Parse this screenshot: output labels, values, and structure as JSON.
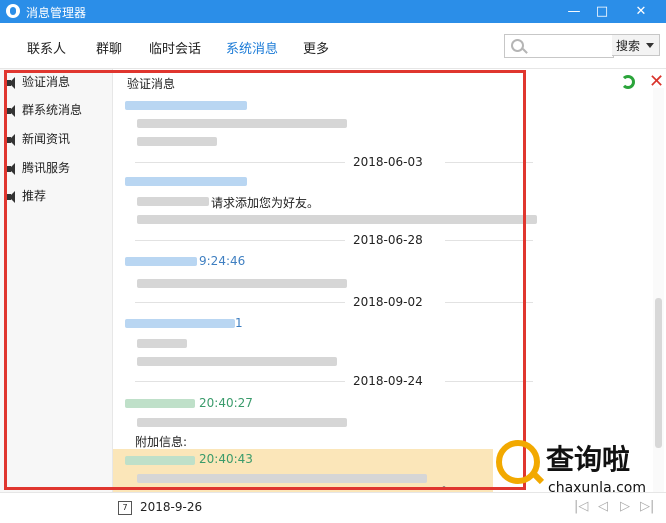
{
  "window": {
    "title": "消息管理器",
    "minimize": "—",
    "maximize": "□",
    "close": "✕"
  },
  "tabs": [
    "联系人",
    "群聊",
    "临时会话",
    "系统消息",
    "更多"
  ],
  "search": {
    "placeholder": "",
    "button": "搜索"
  },
  "sidebar": {
    "items": [
      "验证消息",
      "群系统消息",
      "新闻资讯",
      "腾讯服务",
      "推荐"
    ]
  },
  "content": {
    "title": "验证消息",
    "dates": [
      "2018-06-03",
      "2018-06-28",
      "2018-09-02",
      "2018-09-24"
    ],
    "messages": {
      "m2_text": "请求添加您为好友。",
      "m3_time": "9:24:46",
      "m4_time": "1",
      "m5_time": "20:40:27",
      "m5_text": "附加信息:",
      "m6_time": "20:40:43"
    }
  },
  "status": {
    "date": "2018-9-26",
    "nav": [
      "|◁",
      "◁",
      "▷",
      "▷|"
    ]
  },
  "watermark": {
    "title": "查询啦",
    "subtitle": "chaxunla.com"
  },
  "colors": {
    "titlebar": "#2b8ee8",
    "accent": "#1b7bd7",
    "highlight_box": "#e0362f",
    "selected_row": "#fbe6b9"
  }
}
